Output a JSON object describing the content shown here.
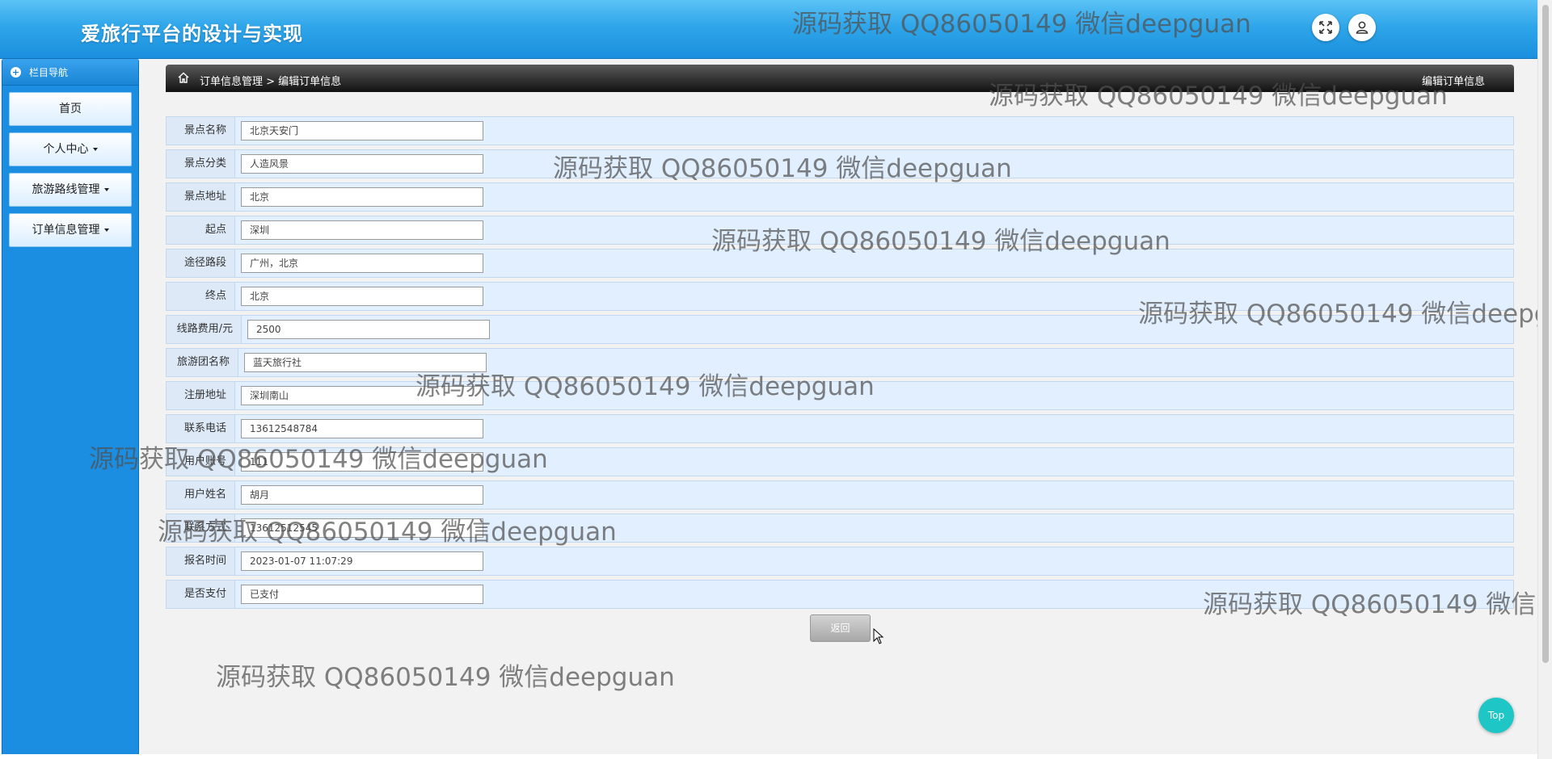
{
  "app_title": "爱旅行平台的设计与实现",
  "header": {
    "fullscreen_icon": "expand-icon",
    "user_icon": "user-icon"
  },
  "sidebar": {
    "title": "栏目导航",
    "items": [
      {
        "label": "首页",
        "has_caret": false
      },
      {
        "label": "个人中心",
        "has_caret": true
      },
      {
        "label": "旅游路线管理",
        "has_caret": true
      },
      {
        "label": "订单信息管理",
        "has_caret": true
      }
    ]
  },
  "breadcrumb": {
    "trail": "订单信息管理 > 编辑订单信息",
    "right_title": "编辑订单信息"
  },
  "form": {
    "fields": [
      {
        "label": "景点名称",
        "value": "北京天安门"
      },
      {
        "label": "景点分类",
        "value": "人造风景"
      },
      {
        "label": "景点地址",
        "value": "北京"
      },
      {
        "label": "起点",
        "value": "深圳"
      },
      {
        "label": "途径路段",
        "value": "广州，北京"
      },
      {
        "label": "终点",
        "value": "北京"
      },
      {
        "label": "线路费用/元",
        "value": "2500"
      },
      {
        "label": "旅游团名称",
        "value": "蓝天旅行社"
      },
      {
        "label": "注册地址",
        "value": "深圳南山"
      },
      {
        "label": "联系电话",
        "value": "13612548784"
      },
      {
        "label": "用户账号",
        "value": "111"
      },
      {
        "label": "用户姓名",
        "value": "胡月"
      },
      {
        "label": "联系方式",
        "value": "13612512545"
      },
      {
        "label": "报名时间",
        "value": "2023-01-07 11:07:29"
      },
      {
        "label": "是否支付",
        "value": "已支付"
      }
    ],
    "back_label": "返回"
  },
  "top_label": "Top",
  "watermark": "源码获取 QQ86050149 微信deepguan",
  "colors": {
    "header": "#2fa6ea",
    "sidebar": "#1c8ee2",
    "row": "#e1efff",
    "top_button": "#1fc6c6"
  }
}
